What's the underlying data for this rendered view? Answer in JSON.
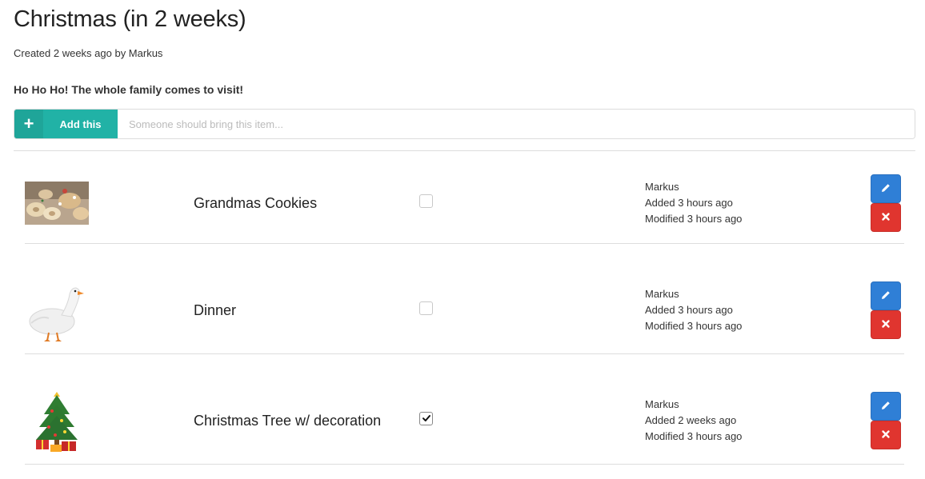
{
  "event": {
    "title": "Christmas (in 2 weeks)",
    "meta": "Created 2 weeks ago by Markus",
    "description": "Ho Ho Ho! The whole family comes to visit!"
  },
  "add_bar": {
    "plus_icon": "plus-icon",
    "button_label": "Add this",
    "input_value": "",
    "placeholder": "Someone should bring this item..."
  },
  "items": [
    {
      "name": "Grandmas Cookies",
      "image": "cookies-image",
      "checked": false,
      "author": "Markus",
      "added": "Added 3 hours ago",
      "modified": "Modified 3 hours ago"
    },
    {
      "name": "Dinner",
      "image": "goose-image",
      "checked": false,
      "author": "Markus",
      "added": "Added 3 hours ago",
      "modified": "Modified 3 hours ago"
    },
    {
      "name": "Christmas Tree w/ decoration",
      "image": "christmas-tree-image",
      "checked": true,
      "author": "Markus",
      "added": "Added 2 weeks ago",
      "modified": "Modified 3 hours ago"
    }
  ],
  "icons": {
    "edit": "pencil-icon",
    "delete": "close-icon",
    "check": "checkmark-icon"
  },
  "colors": {
    "accent": "#21b2a6",
    "edit_button": "#2f7fd6",
    "delete_button": "#e0352f"
  }
}
